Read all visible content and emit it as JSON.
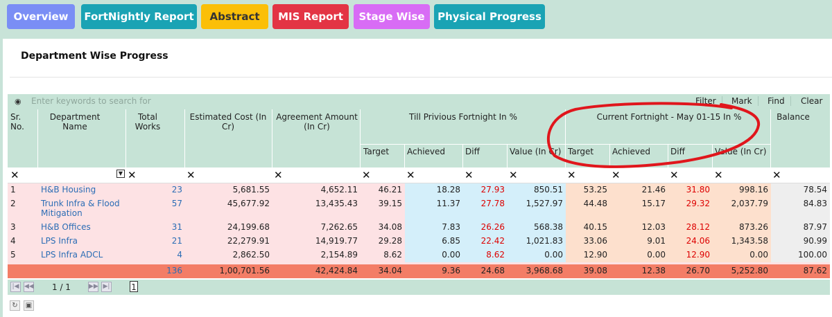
{
  "tabs": [
    {
      "label": "Overview",
      "color": "#7a8ef5"
    },
    {
      "label": "FortNightly Report",
      "color": "#1aa3b4"
    },
    {
      "label": "Abstract",
      "color": "#fbbf08"
    },
    {
      "label": "MIS Report",
      "color": "#e33444"
    },
    {
      "label": "Stage Wise",
      "color": "#d86cf5"
    },
    {
      "label": "Physical Progress",
      "color": "#1aa3b4"
    }
  ],
  "section_title": "Department Wise Progress",
  "search": {
    "placeholder": "Enter keywords to search for",
    "filter": "Filter",
    "mark": "Mark",
    "find": "Find",
    "clear": "Clear"
  },
  "headers": {
    "sr": "Sr. No.",
    "dept": "Department Name",
    "total_works": "Total Works",
    "est_cost": "Estimated Cost (In Cr)",
    "agreement": "Agreement Amount (In Cr)",
    "till_prev": "Till Privious Fortnight In %",
    "current": "Current Fortnight - May 01-15 In %",
    "balance": "Balance",
    "target": "Target",
    "achieved": "Achieved",
    "diff": "Diff",
    "value": "Value (In Cr)"
  },
  "filter_mark": "✕",
  "rows": [
    {
      "sr": "1",
      "dept": "H&B Housing",
      "works": "23",
      "est": "5,681.55",
      "agr": "4,652.11",
      "pt": "46.21",
      "pa": "18.28",
      "pd": "27.93",
      "pv": "850.51",
      "ct": "53.25",
      "ca": "21.46",
      "cd": "31.80",
      "cv": "998.16",
      "bal": "78.54"
    },
    {
      "sr": "2",
      "dept": "Trunk Infra & Flood Mitigation",
      "works": "57",
      "est": "45,677.92",
      "agr": "13,435.43",
      "pt": "39.15",
      "pa": "11.37",
      "pd": "27.78",
      "pv": "1,527.97",
      "ct": "44.48",
      "ca": "15.17",
      "cd": "29.32",
      "cv": "2,037.79",
      "bal": "84.83"
    },
    {
      "sr": "3",
      "dept": "H&B Offices",
      "works": "31",
      "est": "24,199.68",
      "agr": "7,262.65",
      "pt": "34.08",
      "pa": "7.83",
      "pd": "26.26",
      "pv": "568.38",
      "ct": "40.15",
      "ca": "12.03",
      "cd": "28.12",
      "cv": "873.26",
      "bal": "87.97"
    },
    {
      "sr": "4",
      "dept": "LPS Infra",
      "works": "21",
      "est": "22,279.91",
      "agr": "14,919.77",
      "pt": "29.28",
      "pa": "6.85",
      "pd": "22.42",
      "pv": "1,021.83",
      "ct": "33.06",
      "ca": "9.01",
      "cd": "24.06",
      "cv": "1,343.58",
      "bal": "90.99"
    },
    {
      "sr": "5",
      "dept": "LPS Infra ADCL",
      "works": "4",
      "est": "2,862.50",
      "agr": "2,154.89",
      "pt": "8.62",
      "pa": "0.00",
      "pd": "8.62",
      "pv": "0.00",
      "ct": "12.90",
      "ca": "0.00",
      "cd": "12.90",
      "cv": "0.00",
      "bal": "100.00"
    }
  ],
  "totals": {
    "works": "136",
    "est": "1,00,701.56",
    "agr": "42,424.84",
    "pt": "34.04",
    "pa": "9.36",
    "pd": "24.68",
    "pv": "3,968.68",
    "ct": "39.08",
    "ca": "12.38",
    "cd": "26.70",
    "cv": "5,252.80",
    "bal": "87.62"
  },
  "pager": {
    "info": "1 / 1",
    "page": "1"
  },
  "annotation_color": "#e0161c"
}
